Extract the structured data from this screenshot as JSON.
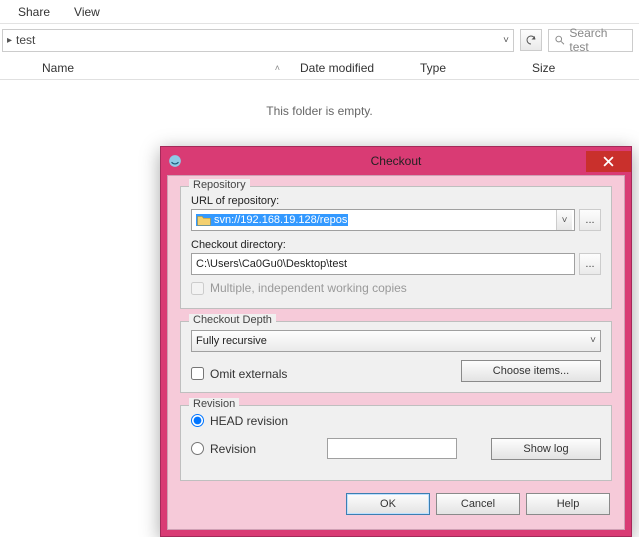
{
  "ribbon": {
    "tabs": [
      "Share",
      "View"
    ]
  },
  "address": {
    "current": "test",
    "search_placeholder": "Search test"
  },
  "columns": {
    "name": "Name",
    "date": "Date modified",
    "type": "Type",
    "size": "Size"
  },
  "body": {
    "empty": "This folder is empty."
  },
  "dialog": {
    "title": "Checkout",
    "repo": {
      "group_label": "Repository",
      "url_label": "URL of repository:",
      "url_value": "svn://192.168.19.128/repos",
      "dir_label": "Checkout directory:",
      "dir_value": "C:\\Users\\Ca0Gu0\\Desktop\\test",
      "multi_label": "Multiple, independent working copies"
    },
    "depth": {
      "group_label": "Checkout Depth",
      "value": "Fully recursive",
      "omit": "Omit externals",
      "choose": "Choose items..."
    },
    "rev": {
      "group_label": "Revision",
      "head": "HEAD revision",
      "rev": "Revision",
      "showlog": "Show log"
    },
    "buttons": {
      "ok": "OK",
      "cancel": "Cancel",
      "help": "Help"
    }
  }
}
